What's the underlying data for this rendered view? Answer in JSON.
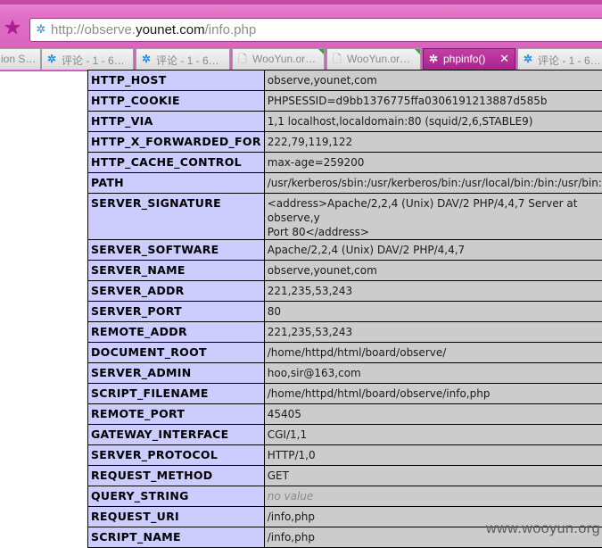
{
  "browser": {
    "url_prefix": "http://observe.",
    "url_host": "younet.com",
    "url_path": "/info.php",
    "tabs": [
      {
        "label": "ion S…",
        "icon": "page"
      },
      {
        "label": "评论 - 1 - 6…",
        "icon": "favicon"
      },
      {
        "label": "评论 - 1 - 6…",
        "icon": "favicon"
      },
      {
        "label": "WooYun.or…",
        "icon": "page"
      },
      {
        "label": "WooYun.or…",
        "icon": "page"
      },
      {
        "label": "phpinfo()",
        "icon": "favicon",
        "active": true
      },
      {
        "label": "评论 - 1 - 6…",
        "icon": "favicon"
      }
    ],
    "accent_color": "#d35cb9"
  },
  "phpinfo": {
    "rows": [
      {
        "key": "HTTP_HOST",
        "value": "observe,younet,com"
      },
      {
        "key": "HTTP_COOKIE",
        "value": "PHPSESSID=d9bb1376775ffa0306191213887d585b"
      },
      {
        "key": "HTTP_VIA",
        "value": "1,1 localhost,localdomain:80 (squid/2,6,STABLE9)"
      },
      {
        "key": "HTTP_X_FORWARDED_FOR",
        "value": "222,79,119,122"
      },
      {
        "key": "HTTP_CACHE_CONTROL",
        "value": "max-age=259200"
      },
      {
        "key": "PATH",
        "value": "/usr/kerberos/sbin:/usr/kerberos/bin:/usr/local/bin:/bin:/usr/bin:/"
      },
      {
        "key": "SERVER_SIGNATURE",
        "value": "<address>Apache/2,2,4 (Unix) DAV/2 PHP/4,4,7 Server at observe,y",
        "value2": "Port 80</address>"
      },
      {
        "key": "SERVER_SOFTWARE",
        "value": "Apache/2,2,4 (Unix) DAV/2 PHP/4,4,7"
      },
      {
        "key": "SERVER_NAME",
        "value": "observe,younet,com"
      },
      {
        "key": "SERVER_ADDR",
        "value": "221,235,53,243"
      },
      {
        "key": "SERVER_PORT",
        "value": "80"
      },
      {
        "key": "REMOTE_ADDR",
        "value": "221,235,53,243"
      },
      {
        "key": "DOCUMENT_ROOT",
        "value": "/home/httpd/html/board/observe/"
      },
      {
        "key": "SERVER_ADMIN",
        "value": "hoo,sir@163,com"
      },
      {
        "key": "SCRIPT_FILENAME",
        "value": "/home/httpd/html/board/observe/info,php"
      },
      {
        "key": "REMOTE_PORT",
        "value": "45405"
      },
      {
        "key": "GATEWAY_INTERFACE",
        "value": "CGI/1,1"
      },
      {
        "key": "SERVER_PROTOCOL",
        "value": "HTTP/1,0"
      },
      {
        "key": "REQUEST_METHOD",
        "value": "GET"
      },
      {
        "key": "QUERY_STRING",
        "value": "no value",
        "novalue": true
      },
      {
        "key": "REQUEST_URI",
        "value": "/info,php"
      },
      {
        "key": "SCRIPT_NAME",
        "value": "/info,php"
      }
    ]
  },
  "watermark": "www.wooyun.org"
}
